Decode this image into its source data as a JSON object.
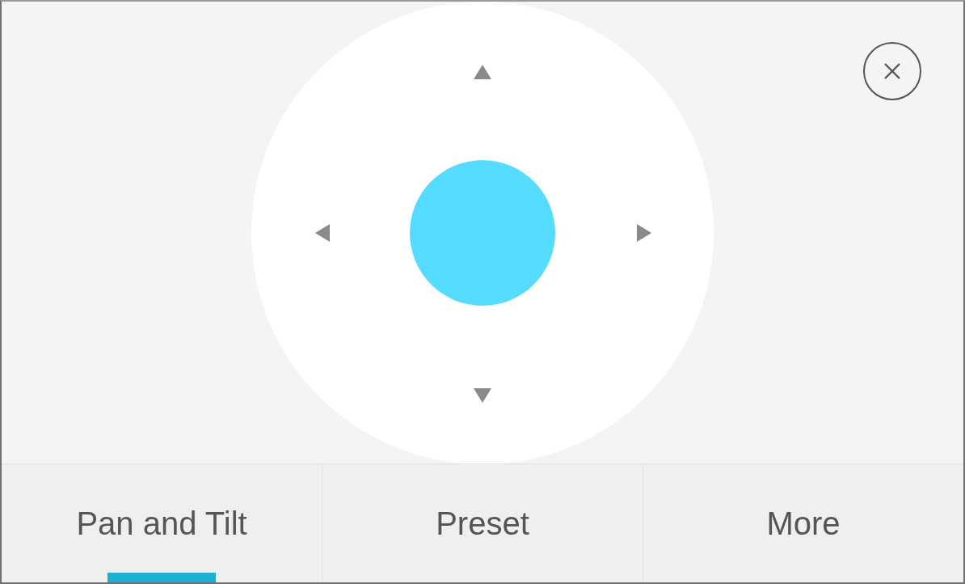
{
  "tabs": [
    {
      "label": "Pan and Tilt",
      "selected": true
    },
    {
      "label": "Preset",
      "selected": false
    },
    {
      "label": "More",
      "selected": false
    }
  ]
}
